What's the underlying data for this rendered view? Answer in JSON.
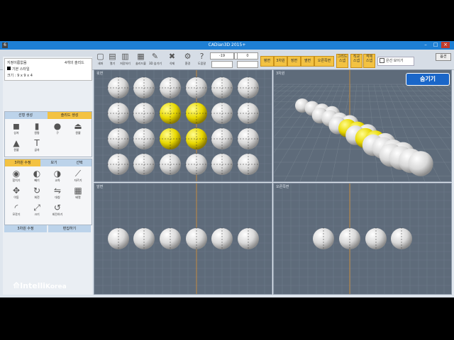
{
  "window": {
    "title": "CADian3D 2015+",
    "app_icon": "6"
  },
  "toolbar": {
    "buttons": [
      {
        "icon": "new-icon",
        "label": "새파"
      },
      {
        "icon": "open-icon",
        "label": "열기"
      },
      {
        "icon": "save-icon",
        "label": "저장하기"
      },
      {
        "icon": "save-as-icon",
        "label": "솔리드블"
      },
      {
        "icon": "tool-icon",
        "label": "3D 숨기기"
      },
      {
        "icon": "delete-icon",
        "label": "삭제"
      },
      {
        "icon": "settings-icon",
        "label": "환경"
      },
      {
        "icon": "help-icon",
        "label": "도움말"
      }
    ],
    "coords": [
      "-19",
      "-3",
      "0"
    ],
    "views": [
      "평면",
      "3차원",
      "정면",
      "옆면",
      "오른쪽면"
    ],
    "groups": [
      "그리드 스냅",
      "직교 스냅",
      "객체 스냅"
    ],
    "option": "은선 보이기",
    "corner_btn": "옵션"
  },
  "info": {
    "line1": "지정이름없음",
    "line2": "4개의 솔리드",
    "line3": "기본 스타일",
    "line4": "크기 : 9 x 9 x 4"
  },
  "panel1": {
    "tabs": [
      "선형 생성",
      "솔리드 생성"
    ],
    "tools": [
      {
        "icon": "box-icon",
        "label": "상자"
      },
      {
        "icon": "cylinder-icon",
        "label": "원통"
      },
      {
        "icon": "sphere-icon",
        "label": "구"
      },
      {
        "icon": "cone-cut-icon",
        "label": "원뿔"
      },
      {
        "icon": "cone-icon",
        "label": "원뿔"
      },
      {
        "icon": "text-icon",
        "label": "글자"
      }
    ]
  },
  "panel2": {
    "tabs": [
      "3차원 수정",
      "보기",
      "선택"
    ],
    "tools": [
      {
        "icon": "union-icon",
        "label": "합치기"
      },
      {
        "icon": "subtract-icon",
        "label": "빼기"
      },
      {
        "icon": "intersect-icon",
        "label": "교차"
      },
      {
        "icon": "slice-icon",
        "label": "자르기"
      },
      {
        "icon": "move-icon",
        "label": "이동"
      },
      {
        "icon": "rotate-icon",
        "label": "회전"
      },
      {
        "icon": "mirror-icon",
        "label": "대칭"
      },
      {
        "icon": "array-icon",
        "label": "배열"
      },
      {
        "icon": "fillet-icon",
        "label": "모깎기"
      },
      {
        "icon": "scale-icon",
        "label": "크기"
      },
      {
        "icon": "revolve-icon",
        "label": "회전하기"
      }
    ],
    "bottom": [
      "3차원 수정",
      "편집하기"
    ]
  },
  "logo": {
    "brand": "Intelli",
    "suffix": "Korea"
  },
  "viewports": [
    {
      "label": "윗면"
    },
    {
      "label": "3차원"
    },
    {
      "label": "앞면"
    },
    {
      "label": "오른쪽면"
    }
  ],
  "hide_button": "숨기기",
  "colors": {
    "title": "#1e7fd4",
    "accent": "#f3c242",
    "viewport": "#5e6b7a",
    "selected": "#e8d800"
  }
}
